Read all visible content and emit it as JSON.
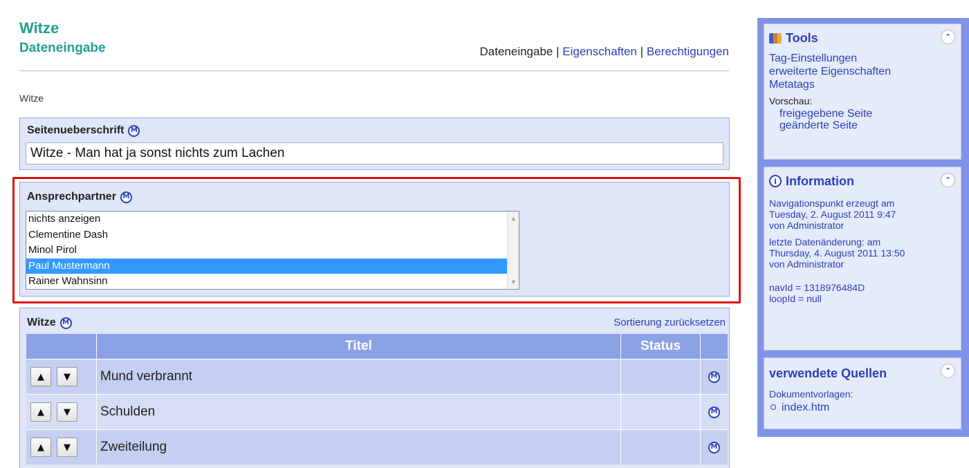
{
  "header": {
    "app_title": "Witze",
    "subtitle": "Dateneingabe",
    "tabs": [
      {
        "label": "Dateneingabe"
      },
      {
        "label": "Eigenschaften"
      },
      {
        "label": "Berechtigungen"
      }
    ],
    "tab_separator": "|",
    "breadcrumb": "Witze"
  },
  "fields": {
    "title": {
      "label": "Seitenueberschrift",
      "value": "Witze - Man hat ja sonst nichts zum Lachen"
    },
    "contact": {
      "label": "Ansprechpartner",
      "options": [
        "nichts anzeigen",
        "Clementine Dash",
        "Minol Pirol",
        "Paul Mustermann",
        "Rainer Wahnsinn"
      ],
      "selected": "Paul Mustermann"
    },
    "jokes": {
      "label": "Witze",
      "reset_link": "Sortierung zurücksetzen",
      "columns": [
        "Titel",
        "Status"
      ],
      "rows": [
        {
          "title": "Mund verbrannt",
          "status": ""
        },
        {
          "title": "Schulden",
          "status": ""
        },
        {
          "title": "Zweiteilung",
          "status": ""
        }
      ]
    }
  },
  "icons": {
    "m_glyph": "M",
    "up_glyph": "▲",
    "down_glyph": "▼",
    "collapse_glyph": "⌃",
    "info_glyph": "i"
  },
  "sidebar": {
    "tools": {
      "title": "Tools",
      "links": [
        "Tag-Einstellungen",
        "erweiterte Eigenschaften",
        "Metatags"
      ],
      "preview_label": "Vorschau:",
      "preview_links": [
        "freigegebene Seite",
        "geänderte Seite"
      ]
    },
    "information": {
      "title": "Information",
      "created": [
        "Navigationspunkt erzeugt am",
        "Tuesday, 2. August 2011 9:47",
        "von Administrator"
      ],
      "changed": [
        "letzte Datenänderung: am",
        "Thursday, 4. August 2011 13:50",
        "von Administrator"
      ],
      "ids": [
        "navId = 1318976484D",
        "loopId = null"
      ]
    },
    "sources": {
      "title": "verwendete Quellen",
      "label": "Dokumentvorlagen:",
      "items": [
        "index.htm"
      ]
    }
  },
  "colors": {
    "accent_teal": "#20a090",
    "link_blue": "#2a3fb5",
    "highlight_red": "#e01010",
    "selection_blue": "#3399ff",
    "sidebar_blue": "#7f94e6"
  }
}
